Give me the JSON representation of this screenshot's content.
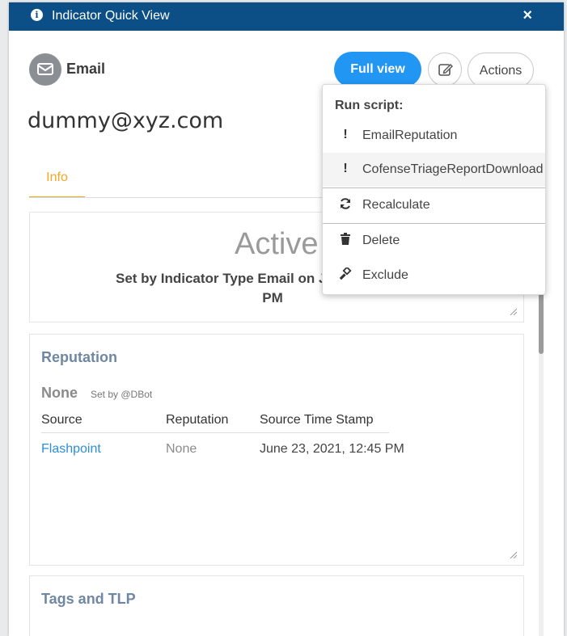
{
  "window": {
    "title": "Indicator Quick View",
    "close": "×"
  },
  "indicator": {
    "type": "Email",
    "value": "dummy@xyz.com"
  },
  "toolbar": {
    "full_view": "Full view",
    "actions": "Actions"
  },
  "tabs": [
    {
      "label": "Info"
    }
  ],
  "state_card": {
    "status": "Active",
    "set_by": "Set by Indicator Type Email on Ju",
    "set_by_tail": "PM"
  },
  "reputation": {
    "title": "Reputation",
    "score": "None",
    "score_set_by": "Set by @DBot",
    "columns": [
      "Source",
      "Reputation",
      "Source Time Stamp"
    ],
    "rows": [
      {
        "source": "Flashpoint",
        "reputation": "None",
        "timestamp": "June 23, 2021, 12:45 PM"
      }
    ]
  },
  "tags_card": {
    "title": "Tags and TLP"
  },
  "actions_menu": {
    "header": "Run script:",
    "scripts": [
      {
        "label": "EmailReputation",
        "icon": "exclamation-icon"
      },
      {
        "label": "CofenseTriageReportDownload",
        "icon": "exclamation-icon"
      }
    ],
    "recalculate": "Recalculate",
    "delete": "Delete",
    "exclude": "Exclude"
  },
  "colors": {
    "header": "#0b4f86",
    "primary": "#2196f3",
    "tab_active": "#f5a623",
    "link": "#2d8fd6"
  }
}
